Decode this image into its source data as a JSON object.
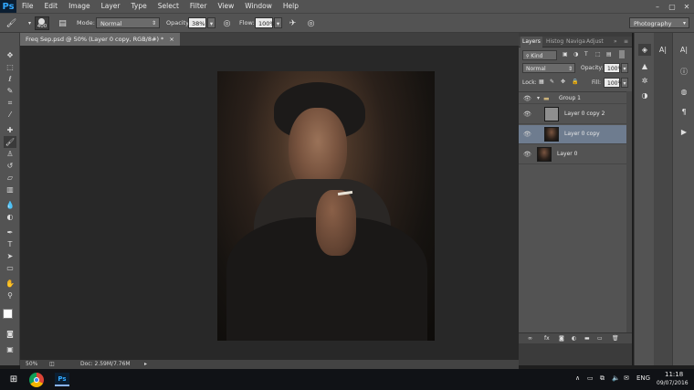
{
  "menubar": {
    "app_logo": "Ps",
    "items": [
      "File",
      "Edit",
      "Image",
      "Layer",
      "Type",
      "Select",
      "Filter",
      "View",
      "Window",
      "Help"
    ],
    "window_controls": [
      "–",
      "▢",
      "✕"
    ]
  },
  "options_bar": {
    "brush_size": "400",
    "mode_label": "Mode:",
    "mode_value": "Normal",
    "opacity_label": "Opacity:",
    "opacity_value": "38%",
    "flow_label": "Flow:",
    "flow_value": "100%",
    "workspace": "Photography"
  },
  "document": {
    "tab_title": "Freq Sep.psd @ 50% (Layer 0 copy, RGB/8#) *",
    "tab_close": "×",
    "zoom": "50%",
    "doc_size": "Doc: 2.59M/7.76M"
  },
  "layers_panel": {
    "tabs": [
      "Layers",
      "Histog",
      "Naviga",
      "Adjust"
    ],
    "kind_label": "Kind",
    "blend_mode": "Normal",
    "opacity_label": "Opacity:",
    "opacity_value": "100%",
    "lock_label": "Lock:",
    "fill_label": "Fill:",
    "fill_value": "100%",
    "layers": [
      {
        "name": "Group 1",
        "type": "group"
      },
      {
        "name": "Layer 0 copy 2",
        "type": "gray"
      },
      {
        "name": "Layer 0 copy",
        "type": "photo",
        "selected": true
      },
      {
        "name": "Layer 0",
        "type": "photo"
      }
    ]
  },
  "taskbar": {
    "language": "ENG",
    "time": "11:18",
    "date": "09/07/2016"
  },
  "colors": {
    "accent_ps": "#31a8ff",
    "selected_layer": "#6e7c8f"
  }
}
